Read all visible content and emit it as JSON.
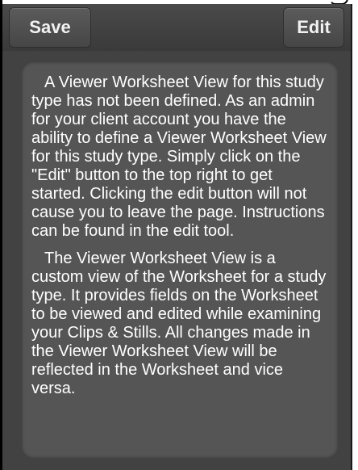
{
  "toolbar": {
    "save_label": "Save",
    "edit_label": "Edit"
  },
  "message": {
    "paragraph_1": "A Viewer Worksheet View for this study type has not been defined. As an admin for your client account you have the ability to define a Viewer Worksheet View for this study type. Simply click on the \"Edit\" button to the top right to get started. Clicking the edit button will not cause you to leave the page. Instructions can be found in the edit tool.",
    "paragraph_2": "The Viewer Worksheet View is a custom view of the Worksheet for a study type. It provides fields on the Worksheet to be viewed and edited while examining your Clips & Stills. All changes made in the Viewer Worksheet View will be reflected in the Worksheet and vice versa."
  },
  "colors": {
    "panel_background": "#424242",
    "message_background": "#555555",
    "text": "#ffffff"
  }
}
